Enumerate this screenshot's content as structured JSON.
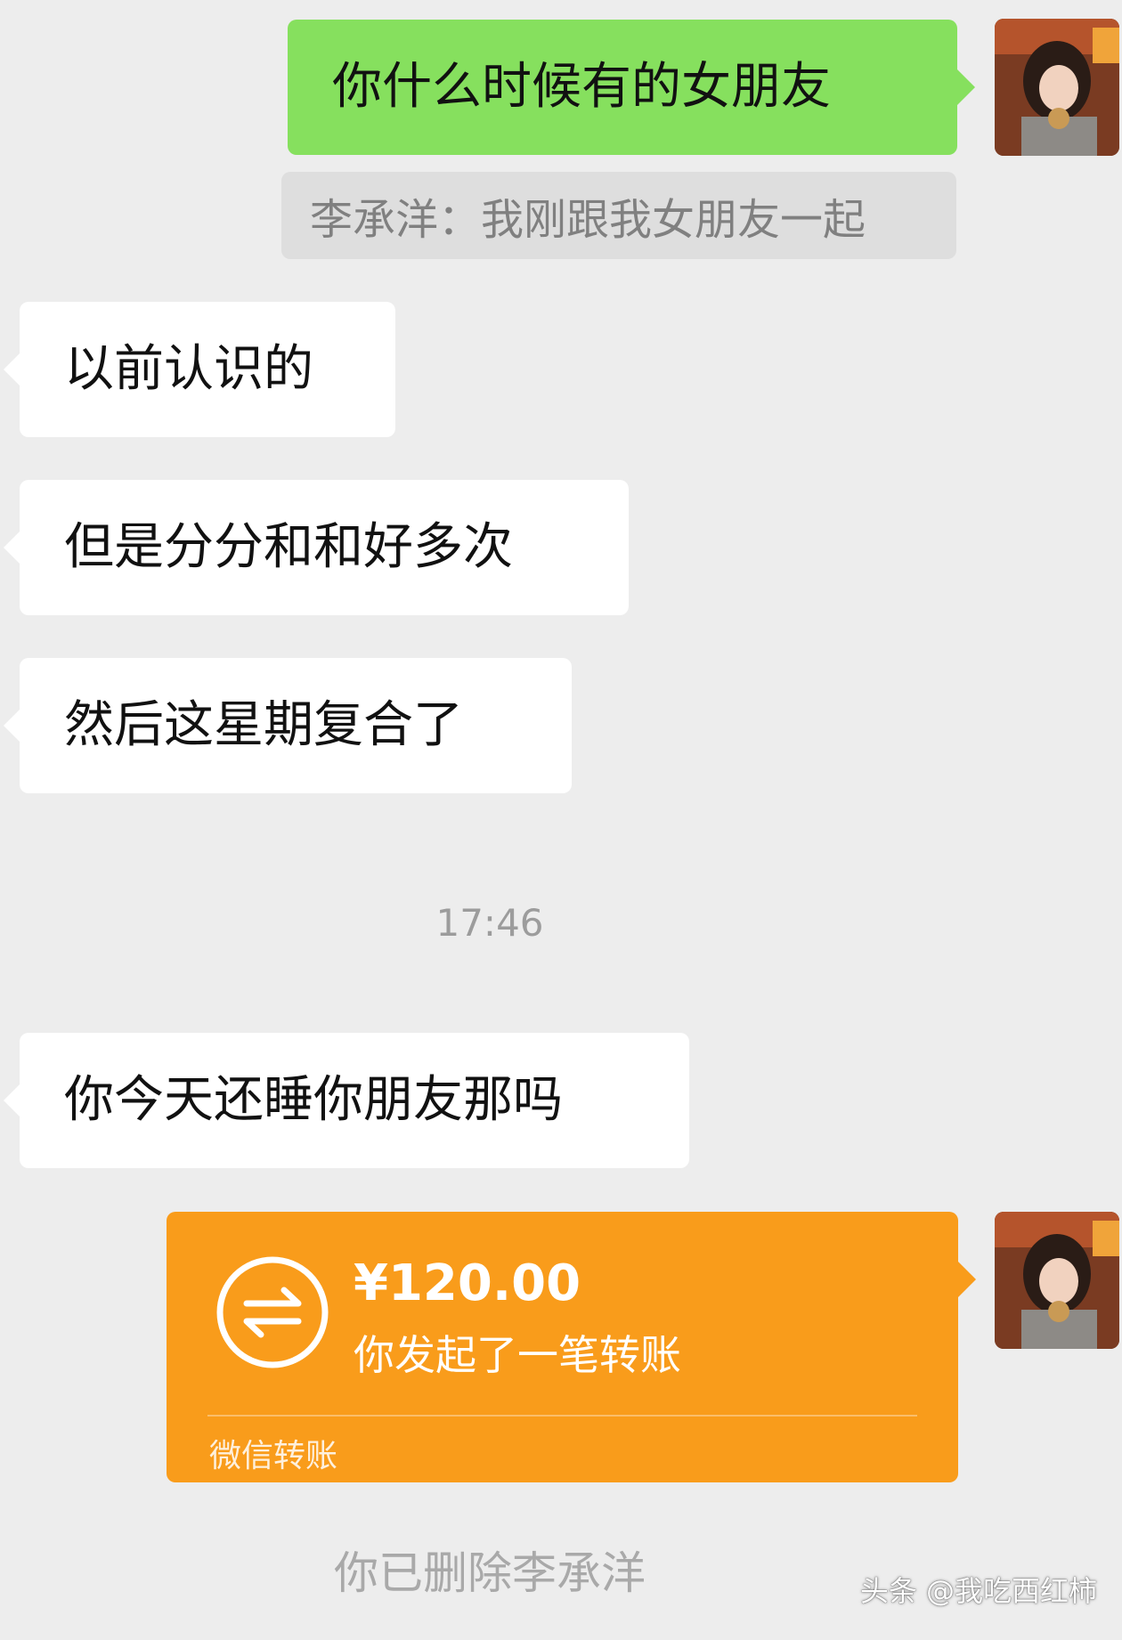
{
  "messages": {
    "out_1": "你什么时候有的女朋友",
    "quote": "李承洋：我刚跟我女朋友一起",
    "in_1": "以前认识的",
    "in_2": "但是分分和和好多次",
    "in_3": "然后这星期复合了",
    "timestamp": "17:46",
    "in_4": "你今天还睡你朋友那吗"
  },
  "transfer": {
    "amount": "¥120.00",
    "description": "你发起了一笔转账",
    "footer": "微信转账",
    "icon": "transfer-arrows-icon"
  },
  "system_notice": "你已删除李承洋",
  "watermark": "头条 @我吃西红柿",
  "colors": {
    "background": "#ededed",
    "outgoing_bubble": "#86e05e",
    "incoming_bubble": "#ffffff",
    "transfer_card": "#f99c1b",
    "quote_bg": "#dedede"
  }
}
